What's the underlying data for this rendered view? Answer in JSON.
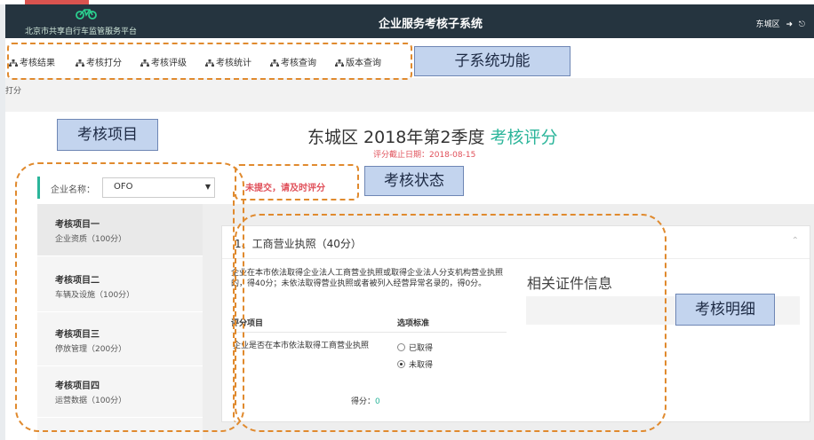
{
  "header": {
    "platform_name": "北京市共享自行车监管服务平台",
    "system_title": "企业服务考核子系统",
    "user_district": "东城区",
    "brand_icon": "bicycle-icon",
    "login_icon": "sign-in-icon",
    "logout_icon": "sign-out-icon"
  },
  "nav": {
    "items": [
      {
        "label": "考核结果",
        "icon": "sitemap-icon"
      },
      {
        "label": "考核打分",
        "icon": "sitemap-icon"
      },
      {
        "label": "考核评级",
        "icon": "sitemap-icon"
      },
      {
        "label": "考核统计",
        "icon": "sitemap-icon"
      },
      {
        "label": "考核查询",
        "icon": "sitemap-icon"
      },
      {
        "label": "版本查询",
        "icon": "sitemap-icon"
      }
    ]
  },
  "subbar": {
    "text": "打分"
  },
  "page": {
    "title_prefix": "东城区 2018年第2季度 ",
    "title_highlight": "考核评分",
    "deadline": "评分截止日期：2018-08-15"
  },
  "company": {
    "label": "企业名称：",
    "selected": "OFO"
  },
  "status": {
    "text": "未提交，请及时评分"
  },
  "sidebar": {
    "items": [
      {
        "title": "考核项目一",
        "sub": "企业资质（100分）"
      },
      {
        "title": "考核项目二",
        "sub": "车辆及设施（100分）"
      },
      {
        "title": "考核项目三",
        "sub": "停放管理（200分）"
      },
      {
        "title": "考核项目四",
        "sub": "运营数据（100分）"
      }
    ]
  },
  "panel": {
    "title": "1、工商营业执照（40分）",
    "description": "企业在本市依法取得企业法人工商营业执照或取得企业法人分支机构营业执照的，得40分；未依法取得营业执照或者被列入经营异常名录的，得0分。",
    "col_item": "评分项目",
    "col_criteria": "选项标准",
    "row_item": "企业是否在本市依法取得工商营业执照",
    "options": [
      {
        "label": "已取得",
        "selected": false
      },
      {
        "label": "未取得",
        "selected": true
      }
    ],
    "score_label": "得分：",
    "score_value": "0"
  },
  "cert": {
    "title": "相关证件信息"
  },
  "callouts": {
    "subsystem": "子系统功能",
    "items": "考核项目",
    "status": "考核状态",
    "detail": "考核明细"
  },
  "colors": {
    "accent": "#2bb59a",
    "header_bg": "#25343f",
    "alert": "#e0505a",
    "dash": "#e08a2e"
  }
}
